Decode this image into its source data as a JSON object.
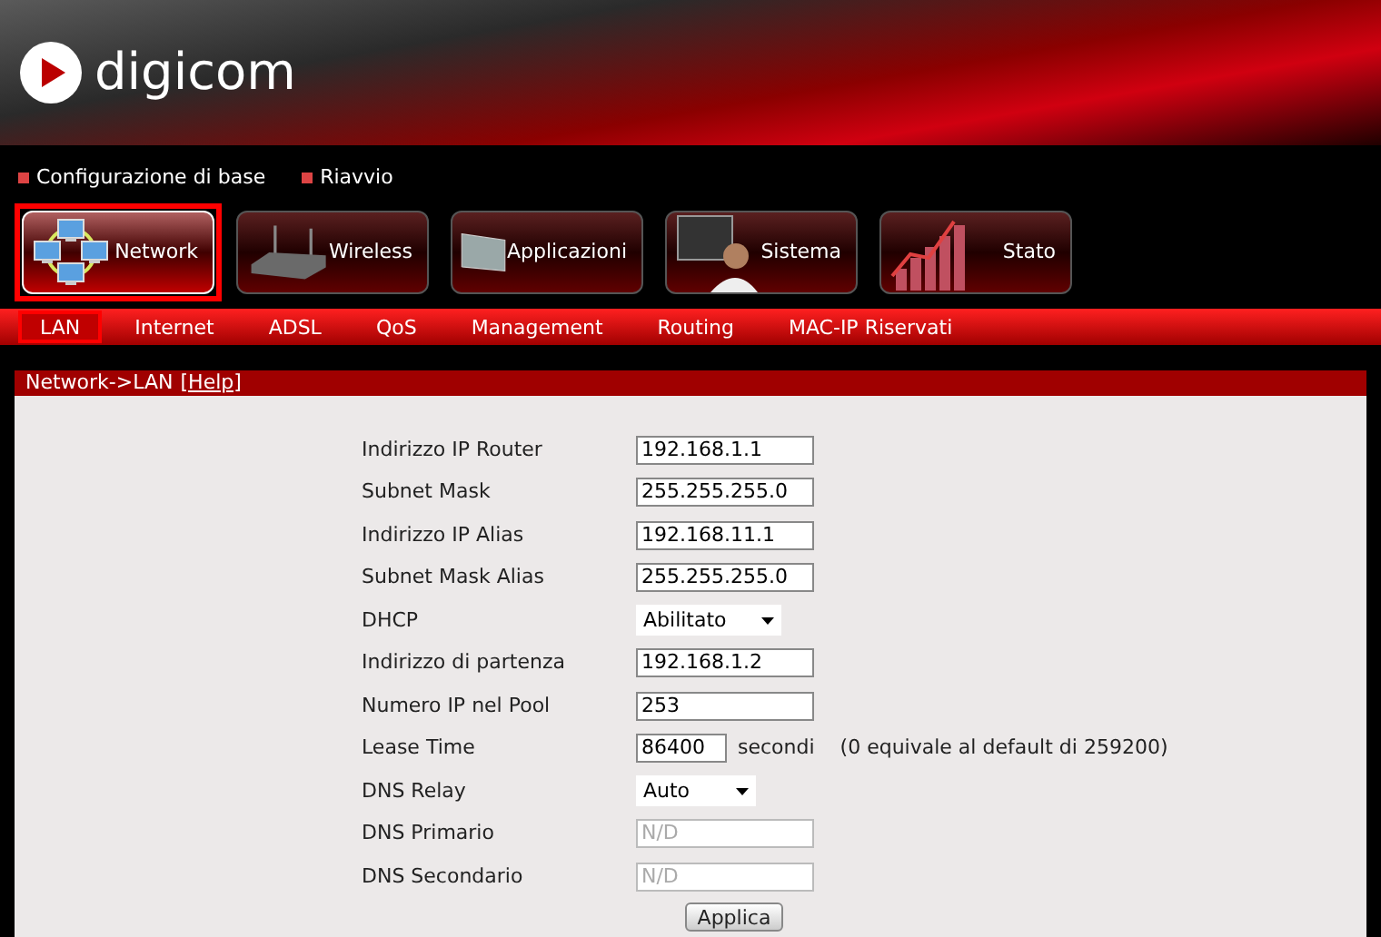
{
  "logo": {
    "text": "digicom"
  },
  "top_links": [
    {
      "label": "Configurazione di base"
    },
    {
      "label": "Riavvio"
    }
  ],
  "nav": [
    {
      "label": "Network",
      "kind": "network",
      "selected": true
    },
    {
      "label": "Wireless",
      "kind": "router",
      "selected": false
    },
    {
      "label": "Applicazioni",
      "kind": "panel",
      "selected": false
    },
    {
      "label": "Sistema",
      "kind": "user",
      "selected": false
    },
    {
      "label": "Stato",
      "kind": "chart",
      "selected": false
    }
  ],
  "subtabs": [
    {
      "label": "LAN",
      "selected": true
    },
    {
      "label": "Internet",
      "selected": false
    },
    {
      "label": "ADSL",
      "selected": false
    },
    {
      "label": "QoS",
      "selected": false
    },
    {
      "label": "Management",
      "selected": false
    },
    {
      "label": "Routing",
      "selected": false
    },
    {
      "label": "MAC-IP Riservati",
      "selected": false
    }
  ],
  "panel": {
    "breadcrumb": "Network->LAN",
    "help": "[Help]"
  },
  "fields": [
    {
      "label": "Indirizzo IP Router",
      "kind": "text",
      "value": "192.168.1.1",
      "disabled": false
    },
    {
      "label": "Subnet Mask",
      "kind": "text",
      "value": "255.255.255.0",
      "disabled": false
    },
    {
      "label": "Indirizzo IP Alias",
      "kind": "text",
      "value": "192.168.11.1",
      "disabled": false
    },
    {
      "label": "Subnet Mask Alias",
      "kind": "text",
      "value": "255.255.255.0",
      "disabled": false
    },
    {
      "label": "DHCP",
      "kind": "select",
      "value": "Abilitato",
      "disabled": false
    },
    {
      "label": "Indirizzo di partenza",
      "kind": "text",
      "value": "192.168.1.2",
      "disabled": false
    },
    {
      "label": "Numero IP nel Pool",
      "kind": "text",
      "value": "253",
      "disabled": false
    },
    {
      "label": "Lease Time",
      "kind": "short",
      "value": "86400",
      "unit": "secondi",
      "note": "(0 equivale al default di 259200)",
      "disabled": false
    },
    {
      "label": "DNS Relay",
      "kind": "select",
      "value": "Auto",
      "disabled": false
    },
    {
      "label": "DNS Primario",
      "kind": "text",
      "value": "N/D",
      "disabled": true
    },
    {
      "label": "DNS Secondario",
      "kind": "text",
      "value": "N/D",
      "disabled": true
    }
  ],
  "apply_button": "Applica"
}
